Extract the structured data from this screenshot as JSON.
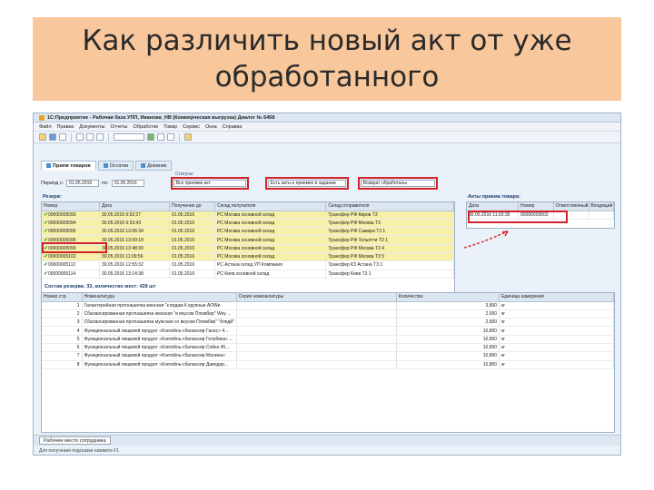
{
  "slide": {
    "title": "Как различить новый акт от уже обработанного"
  },
  "window": {
    "title": "1С:Предприятие - Рабочая база УПП, Иванова_НВ (Коммерческая выгрузка) Диалог № 6458"
  },
  "menu": [
    "Файл",
    "Правка",
    "Документы",
    "Отчеты",
    "Обработки",
    "Товар",
    "Сервис",
    "Окна",
    "Справка"
  ],
  "tabs": [
    {
      "label": "Прием товаров"
    },
    {
      "label": "Остатки"
    },
    {
      "label": "Дневник"
    }
  ],
  "filter": {
    "period_label": "Период с:",
    "date_from": "01.05.2016",
    "date_to_label": "по:",
    "date_to": "01.05.2016",
    "status_caption": "Статусы:",
    "status_all": "Все приемки акт",
    "status_waiting": "Есть акты к приемке в задании",
    "status_processed": "Возврат обработаны"
  },
  "docs_section_label": "Резерв:",
  "acts_section_label": "Акты приема товара:",
  "docs_table": {
    "columns": [
      "Номер",
      "Дата",
      "Получение до",
      "Склад получателя",
      "Склад отправителя"
    ],
    "rows": [
      {
        "num": "00000005093",
        "date": "30.05.2016 9:52:27",
        "due": "01.05.2016",
        "to": "РС Москва основной склад",
        "from": "Трансфер РФ Киров Т3",
        "selected": true
      },
      {
        "num": "00000005094",
        "date": "30.05.2016 9:53:43",
        "due": "01.05.2016",
        "to": "РС Москва основной склад",
        "from": "Трансфер РФ Москва Т3",
        "selected": true
      },
      {
        "num": "00000005095",
        "date": "30.05.2016 13:06:34",
        "due": "01.05.2016",
        "to": "РС Москва основной склад",
        "from": "Трансфер РФ Самара Т3 1",
        "selected": true
      },
      {
        "num": "00000005096",
        "date": "30.05.2016 13:09:18",
        "due": "01.05.2016",
        "to": "РС Москва основной склад",
        "from": "Трансфер РФ Тольятти Т3 1",
        "selected": true
      },
      {
        "num": "00000005099",
        "date": "30.05.2016 13:48:30",
        "due": "01.05.2016",
        "to": "РС Москва основной склад",
        "from": "Трансфер РФ Москва Т3 4",
        "selected": true
      },
      {
        "num": "00000005102",
        "date": "30.05.2016 11:09:56",
        "due": "01.05.2016",
        "to": "РС Москва основной склад",
        "from": "Трансфер РФ Москва Т3 5",
        "selected": true
      },
      {
        "num": "00000005112",
        "date": "30.05.2016 12:55:32",
        "due": "01.05.2016",
        "to": "РС Астана склад УП Компания",
        "from": "Трансфер КЗ Астана Т3 1",
        "selected": false
      },
      {
        "num": "00000005114",
        "date": "30.05.2016 13:14:38",
        "due": "01.05.2016",
        "to": "РС Киев основной склад",
        "from": "Трансфер Киев Т3 1",
        "selected": false
      }
    ]
  },
  "acts_table": {
    "columns": [
      "Дата",
      "Номер",
      "Ответственный",
      "Входящий"
    ],
    "rows": [
      {
        "date": "30.05.2016 11:03:35",
        "num": "00000003502",
        "resp": "",
        "in": ""
      }
    ]
  },
  "summary": "Состав резерва: 33, количество мест: 428 шт",
  "lines_table": {
    "columns": [
      "Номер стр.",
      "Номенклатура",
      "Серия номенклатуры",
      "Количество",
      "Единица измерения"
    ],
    "rows": [
      {
        "n": "1",
        "name": "Галантерейная протнашелка женская \"к водам К крупные AOWe",
        "qty": "3,800",
        "unit": "кг"
      },
      {
        "n": "2",
        "name": "Сбалансированная протнашелка женская \"в вкусом Пломбир\" Wey ...",
        "qty": "2,000",
        "unit": "кг"
      },
      {
        "n": "3",
        "name": "Сбалансированная протнашелка мужская со вкусом Пломбир\" \"бледй\"",
        "qty": "2,900",
        "unit": "кг"
      },
      {
        "n": "4",
        "name": "Функциональный пищевой продукт «Коктейль-сбалансир Ганос» 4...",
        "qty": "10,800",
        "unit": "кг"
      },
      {
        "n": "5",
        "name": "Функциональный пищевой продукт «Коктейль-сбалансир Голубика» ...",
        "qty": "10,800",
        "unit": "кг"
      },
      {
        "n": "6",
        "name": "Функциональный пищевой продукт «Коктейль-сбалансир Сойка 45...",
        "qty": "10,800",
        "unit": "кг"
      },
      {
        "n": "7",
        "name": "Функциональный пищевой продукт «Коктейль-сбалансир Малина»",
        "qty": "10,800",
        "unit": "кг"
      },
      {
        "n": "8",
        "name": "Функциональный пищевой продукт «Коктейль-сбалансир Давндар...",
        "qty": "10,800",
        "unit": "кг"
      }
    ]
  },
  "taskbar": {
    "item": "Рабочее место сотрудника"
  },
  "statusbar": "Для получения подсказки нажмите F1",
  "colors": {
    "title_bg": "#f8c79b",
    "highlight": "#d3232a",
    "selected_row": "#f6f0a8"
  }
}
